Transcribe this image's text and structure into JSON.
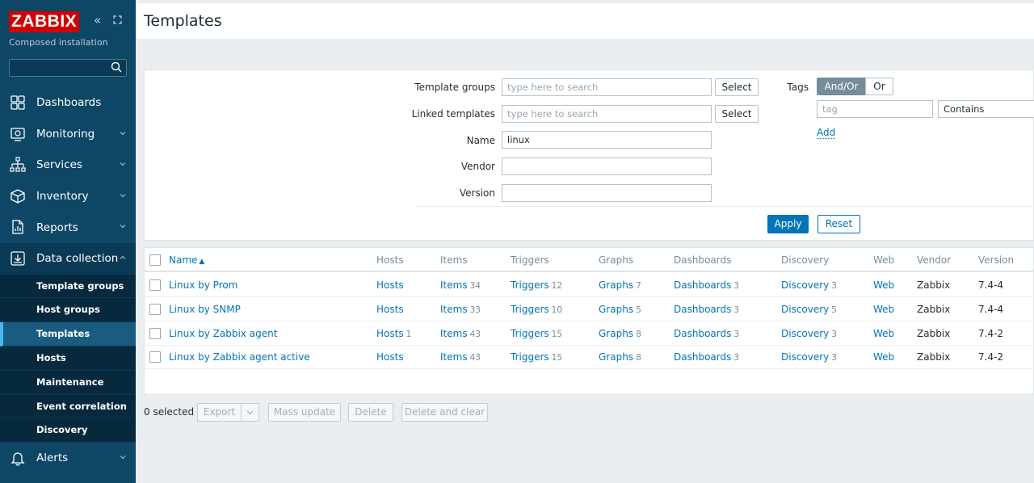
{
  "brand": {
    "logo": "ZABBIX",
    "installation": "Composed installation"
  },
  "sidebar": {
    "items": [
      {
        "label": "Dashboards",
        "icon": "dashboards-icon",
        "expandable": false
      },
      {
        "label": "Monitoring",
        "icon": "monitoring-icon",
        "expandable": true
      },
      {
        "label": "Services",
        "icon": "services-icon",
        "expandable": true
      },
      {
        "label": "Inventory",
        "icon": "inventory-icon",
        "expandable": true
      },
      {
        "label": "Reports",
        "icon": "reports-icon",
        "expandable": true
      },
      {
        "label": "Data collection",
        "icon": "data-collection-icon",
        "expandable": true,
        "open": true
      },
      {
        "label": "Alerts",
        "icon": "alerts-icon",
        "expandable": true
      }
    ],
    "subitems": [
      "Template groups",
      "Host groups",
      "Templates",
      "Hosts",
      "Maintenance",
      "Event correlation",
      "Discovery"
    ],
    "active_subitem": "Templates"
  },
  "page": {
    "title": "Templates"
  },
  "filter": {
    "template_groups_label": "Template groups",
    "linked_templates_label": "Linked templates",
    "name_label": "Name",
    "vendor_label": "Vendor",
    "version_label": "Version",
    "search_placeholder": "type here to search",
    "select_label": "Select",
    "name_value": "linux",
    "vendor_value": "",
    "version_value": "",
    "tags_label": "Tags",
    "andor_label": "And/Or",
    "or_label": "Or",
    "tag_placeholder": "tag",
    "tag_operator": "Contains",
    "add_label": "Add",
    "apply_label": "Apply",
    "reset_label": "Reset"
  },
  "table": {
    "headers": {
      "name": "Name",
      "sort": "▲",
      "hosts": "Hosts",
      "items": "Items",
      "triggers": "Triggers",
      "graphs": "Graphs",
      "dashboards": "Dashboards",
      "discovery": "Discovery",
      "web": "Web",
      "vendor": "Vendor",
      "version": "Version"
    },
    "rows": [
      {
        "name": "Linux by Prom",
        "hosts": "Hosts",
        "hosts_count": "",
        "items": "Items",
        "items_count": "34",
        "triggers": "Triggers",
        "triggers_count": "12",
        "graphs": "Graphs",
        "graphs_count": "7",
        "dashboards": "Dashboards",
        "dashboards_count": "3",
        "discovery": "Discovery",
        "discovery_count": "3",
        "web": "Web",
        "vendor": "Zabbix",
        "version": "7.4-4"
      },
      {
        "name": "Linux by SNMP",
        "hosts": "Hosts",
        "hosts_count": "",
        "items": "Items",
        "items_count": "33",
        "triggers": "Triggers",
        "triggers_count": "10",
        "graphs": "Graphs",
        "graphs_count": "5",
        "dashboards": "Dashboards",
        "dashboards_count": "3",
        "discovery": "Discovery",
        "discovery_count": "5",
        "web": "Web",
        "vendor": "Zabbix",
        "version": "7.4-4"
      },
      {
        "name": "Linux by Zabbix agent",
        "hosts": "Hosts",
        "hosts_count": "1",
        "items": "Items",
        "items_count": "43",
        "triggers": "Triggers",
        "triggers_count": "15",
        "graphs": "Graphs",
        "graphs_count": "8",
        "dashboards": "Dashboards",
        "dashboards_count": "3",
        "discovery": "Discovery",
        "discovery_count": "3",
        "web": "Web",
        "vendor": "Zabbix",
        "version": "7.4-2"
      },
      {
        "name": "Linux by Zabbix agent active",
        "hosts": "Hosts",
        "hosts_count": "",
        "items": "Items",
        "items_count": "43",
        "triggers": "Triggers",
        "triggers_count": "15",
        "graphs": "Graphs",
        "graphs_count": "8",
        "dashboards": "Dashboards",
        "dashboards_count": "3",
        "discovery": "Discovery",
        "discovery_count": "3",
        "web": "Web",
        "vendor": "Zabbix",
        "version": "7.4-2"
      }
    ]
  },
  "actions": {
    "selected": "0 selected",
    "export": "Export",
    "mass_update": "Mass update",
    "delete": "Delete",
    "delete_clear": "Delete and clear"
  },
  "colors": {
    "sidebar": "#0e4766",
    "accent": "#0275b8",
    "logo": "#d40000",
    "background": "#ebeef0"
  }
}
